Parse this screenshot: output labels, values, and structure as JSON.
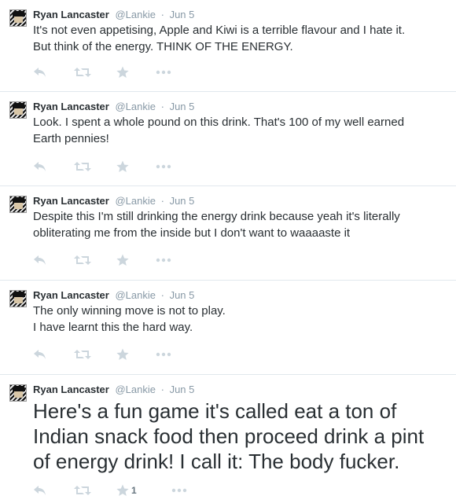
{
  "tweets": [
    {
      "name": "Ryan Lancaster",
      "handle": "@Lankie",
      "separator": "·",
      "time": "Jun 5",
      "lines": [
        "It's not even appetising, Apple and Kiwi is a terrible flavour and I hate it.",
        "But think of the energy. THINK OF THE ENERGY."
      ],
      "favorite_count": ""
    },
    {
      "name": "Ryan Lancaster",
      "handle": "@Lankie",
      "separator": "·",
      "time": "Jun 5",
      "lines": [
        "Look. I spent a whole pound on this drink. That's 100 of my well earned",
        "Earth pennies!"
      ],
      "favorite_count": ""
    },
    {
      "name": "Ryan Lancaster",
      "handle": "@Lankie",
      "separator": "·",
      "time": "Jun 5",
      "lines": [
        "Despite this I'm still drinking the energy drink because yeah it's literally",
        "obliterating me from the inside but I don't want to waaaaste it"
      ],
      "favorite_count": ""
    },
    {
      "name": "Ryan Lancaster",
      "handle": "@Lankie",
      "separator": "·",
      "time": "Jun 5",
      "lines": [
        "The only winning move is not to play.",
        "I have learnt this the hard way."
      ],
      "favorite_count": ""
    },
    {
      "name": "Ryan Lancaster",
      "handle": "@Lankie",
      "separator": "·",
      "time": "Jun 5",
      "lines": [
        "Here's a fun game it's called eat a ton of",
        "Indian snack food then proceed drink a pint",
        "of energy drink! I call it: The body fucker."
      ],
      "favorite_count": "1"
    }
  ],
  "icons": {
    "reply": "reply-icon",
    "retweet": "retweet-icon",
    "favorite": "star-icon",
    "more": "more-icon"
  },
  "colors": {
    "text": "#292f33",
    "meta": "#8899a6",
    "icon": "#ccd6dd",
    "divider": "#e1e8ed"
  }
}
